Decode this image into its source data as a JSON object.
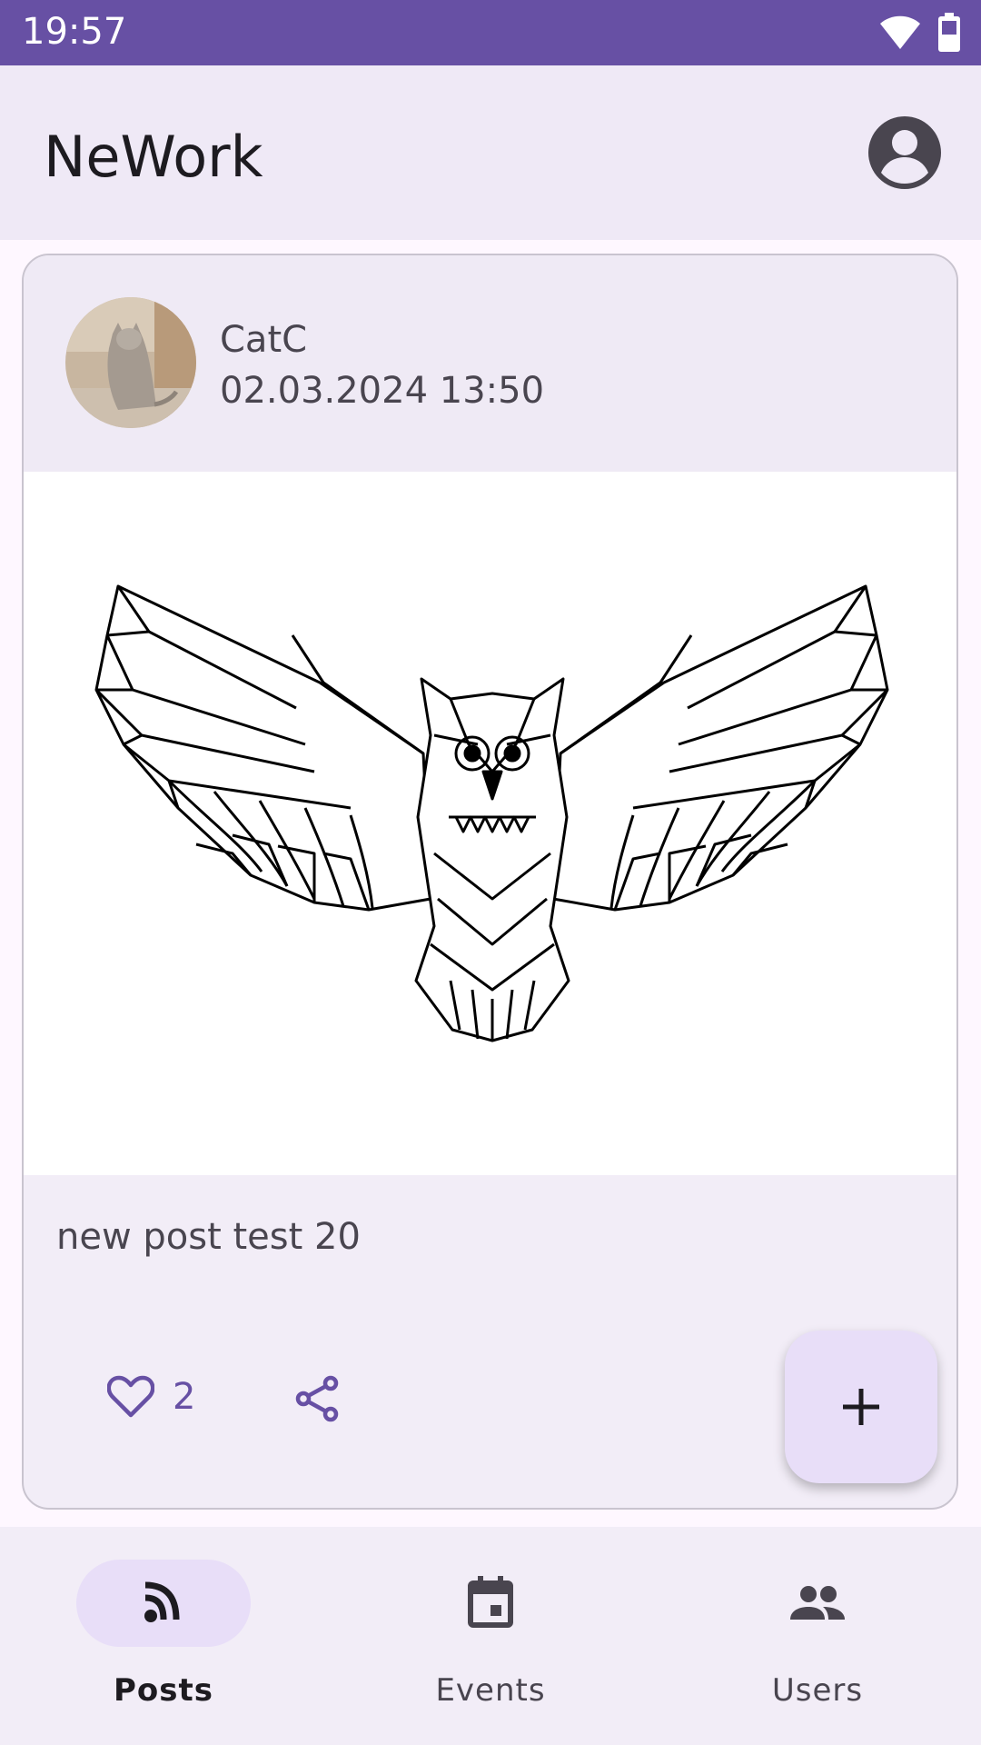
{
  "status_bar": {
    "time": "19:57"
  },
  "app_bar": {
    "title": "NeWork",
    "account_icon": "account-circle-icon"
  },
  "post": {
    "author": "CatC",
    "published": "02.03.2024 13:50",
    "content": "new post test 20",
    "likes": "2",
    "like_icon": "heart-outline-icon",
    "share_icon": "share-icon"
  },
  "fab": {
    "icon": "plus-icon"
  },
  "nav": {
    "items": [
      {
        "label": "Posts",
        "icon": "rss-feed-icon",
        "active": true
      },
      {
        "label": "Events",
        "icon": "calendar-event-icon",
        "active": false
      },
      {
        "label": "Users",
        "icon": "people-icon",
        "active": false
      }
    ]
  },
  "colors": {
    "primary": "#6750A4",
    "surface": "#FEF7FF",
    "container": "#E8DEF8"
  }
}
